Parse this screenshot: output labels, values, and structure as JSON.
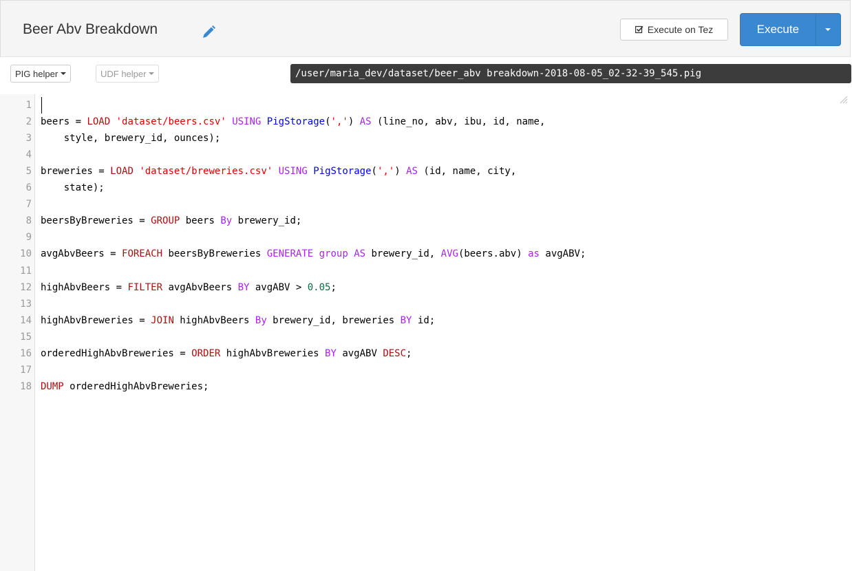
{
  "header": {
    "title": "Beer Abv Breakdown",
    "execute_tez_label": "Execute on Tez",
    "execute_label": "Execute"
  },
  "toolbar": {
    "pig_helper_label": "PIG helper",
    "udf_helper_label": "UDF helper",
    "file_path": "/user/maria_dev/dataset/beer_abv breakdown-2018-08-05_02-32-39_545.pig"
  },
  "editor": {
    "line_numbers": [
      "1",
      "2",
      "3",
      "4",
      "5",
      "6",
      "7",
      "8",
      "9",
      "10",
      "11",
      "12",
      "13",
      "14",
      "15",
      "16",
      "17",
      "18"
    ],
    "lines": [
      [],
      [
        [
          "beers = ",
          ""
        ],
        [
          "LOAD",
          "kw2"
        ],
        [
          " ",
          ""
        ],
        [
          "'dataset/beers.csv'",
          "str"
        ],
        [
          " ",
          ""
        ],
        [
          "USING",
          "kw"
        ],
        [
          " ",
          ""
        ],
        [
          "PigStorage",
          "fn"
        ],
        [
          "(",
          ""
        ],
        [
          "','",
          "str"
        ],
        [
          ") ",
          ""
        ],
        [
          "AS",
          "kw"
        ],
        [
          " (line_no, abv, ibu, id, name,",
          ""
        ]
      ],
      [
        [
          "    style, brewery_id, ounces);",
          ""
        ]
      ],
      [],
      [
        [
          "breweries = ",
          ""
        ],
        [
          "LOAD",
          "kw2"
        ],
        [
          " ",
          ""
        ],
        [
          "'dataset/breweries.csv'",
          "str"
        ],
        [
          " ",
          ""
        ],
        [
          "USING",
          "kw"
        ],
        [
          " ",
          ""
        ],
        [
          "PigStorage",
          "fn"
        ],
        [
          "(",
          ""
        ],
        [
          "','",
          "str"
        ],
        [
          ") ",
          ""
        ],
        [
          "AS",
          "kw"
        ],
        [
          " (id, name, city,",
          ""
        ]
      ],
      [
        [
          "    state);",
          ""
        ]
      ],
      [],
      [
        [
          "beersByBreweries = ",
          ""
        ],
        [
          "GROUP",
          "kw2"
        ],
        [
          " beers ",
          ""
        ],
        [
          "By",
          "kw"
        ],
        [
          " brewery_id;",
          ""
        ]
      ],
      [],
      [
        [
          "avgAbvBeers = ",
          ""
        ],
        [
          "FOREACH",
          "kw2"
        ],
        [
          " beersByBreweries ",
          ""
        ],
        [
          "GENERATE",
          "kw"
        ],
        [
          " ",
          ""
        ],
        [
          "group",
          "kw"
        ],
        [
          " ",
          ""
        ],
        [
          "AS",
          "kw"
        ],
        [
          " brewery_id, ",
          ""
        ],
        [
          "AVG",
          "kw"
        ],
        [
          "(beers.abv) ",
          ""
        ],
        [
          "as",
          "kw"
        ],
        [
          " avgABV;",
          ""
        ]
      ],
      [],
      [
        [
          "highAbvBeers = ",
          ""
        ],
        [
          "FILTER",
          "kw2"
        ],
        [
          " avgAbvBeers ",
          ""
        ],
        [
          "BY",
          "kw"
        ],
        [
          " avgABV > ",
          ""
        ],
        [
          "0.05",
          "num"
        ],
        [
          ";",
          ""
        ]
      ],
      [],
      [
        [
          "highAbvBreweries = ",
          ""
        ],
        [
          "JOIN",
          "kw2"
        ],
        [
          " highAbvBeers ",
          ""
        ],
        [
          "By",
          "kw"
        ],
        [
          " brewery_id, breweries ",
          ""
        ],
        [
          "BY",
          "kw"
        ],
        [
          " id;",
          ""
        ]
      ],
      [],
      [
        [
          "orderedHighAbvBreweries = ",
          ""
        ],
        [
          "ORDER",
          "kw2"
        ],
        [
          " highAbvBreweries ",
          ""
        ],
        [
          "BY",
          "kw"
        ],
        [
          " avgABV ",
          ""
        ],
        [
          "DESC",
          "kw2"
        ],
        [
          ";",
          ""
        ]
      ],
      [],
      [
        [
          "DUMP",
          "kw2"
        ],
        [
          " orderedHighAbvBreweries;",
          ""
        ]
      ]
    ]
  }
}
